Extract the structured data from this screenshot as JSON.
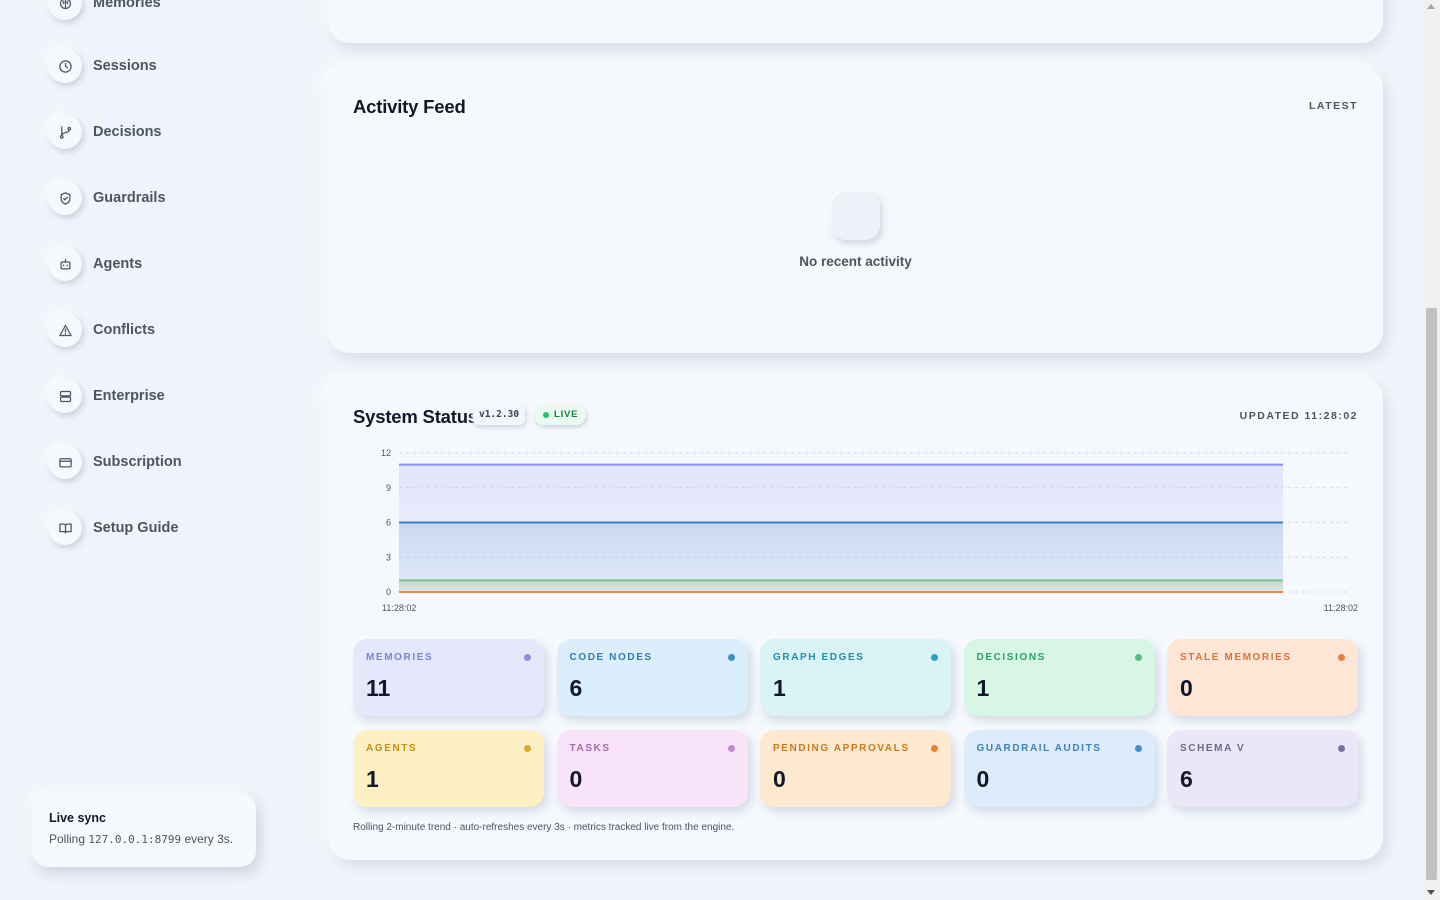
{
  "sidebar": {
    "items": [
      {
        "label": "Memories",
        "icon": "brain-icon"
      },
      {
        "label": "Sessions",
        "icon": "clock-icon"
      },
      {
        "label": "Decisions",
        "icon": "git-branch-icon"
      },
      {
        "label": "Guardrails",
        "icon": "shield-check-icon"
      },
      {
        "label": "Agents",
        "icon": "bot-icon"
      },
      {
        "label": "Conflicts",
        "icon": "warning-icon"
      },
      {
        "label": "Enterprise",
        "icon": "server-icon"
      },
      {
        "label": "Subscription",
        "icon": "credit-card-icon"
      },
      {
        "label": "Setup Guide",
        "icon": "book-open-icon"
      }
    ],
    "live_sync": {
      "title": "Live sync",
      "prefix": "Polling",
      "host": "127.0.0.1:8799",
      "suffix": "every 3s."
    }
  },
  "activity_feed": {
    "title": "Activity Feed",
    "meta": "LATEST",
    "empty_text": "No recent activity"
  },
  "system_status": {
    "title": "System Status",
    "version": "v1.2.30",
    "live_label": "LIVE",
    "updated": "UPDATED 11:28:02",
    "footnote": "Rolling 2-minute trend · auto-refreshes every 3s · metrics tracked live from the engine."
  },
  "chart_data": {
    "type": "area",
    "title": "",
    "xlabel": "",
    "ylabel": "",
    "x": [
      "11:28:02",
      "11:28:02"
    ],
    "ylim": [
      0,
      12
    ],
    "yticks": [
      0,
      3,
      6,
      9,
      12
    ],
    "grid": true,
    "series": [
      {
        "values": [
          11,
          11
        ],
        "color": "#8b8ff0"
      },
      {
        "values": [
          6,
          6
        ],
        "color": "#3b82c4"
      },
      {
        "values": [
          1,
          1
        ],
        "color": "#c9a227"
      },
      {
        "values": [
          1,
          1
        ],
        "color": "#7bc9a0"
      },
      {
        "values": [
          0,
          0
        ],
        "color": "#e98652"
      }
    ]
  },
  "metrics": [
    {
      "label": "MEMORIES",
      "value": "11",
      "bg": "#e5e8fb",
      "color": "#7b82d9",
      "dot": "#8a8fe0"
    },
    {
      "label": "CODE NODES",
      "value": "6",
      "bg": "#dbeefb",
      "color": "#2d7fb5",
      "dot": "#3b90c8"
    },
    {
      "label": "GRAPH EDGES",
      "value": "1",
      "bg": "#d9f3f7",
      "color": "#1f8fa6",
      "dot": "#20a5be"
    },
    {
      "label": "DECISIONS",
      "value": "1",
      "bg": "#d7f6e5",
      "color": "#2f9e68",
      "dot": "#4fbf84"
    },
    {
      "label": "STALE MEMORIES",
      "value": "0",
      "bg": "#fde6d6",
      "color": "#d9733a",
      "dot": "#ec7c45"
    },
    {
      "label": "AGENTS",
      "value": "1",
      "bg": "#fdf0c4",
      "color": "#c58f12",
      "dot": "#e0a72e"
    },
    {
      "label": "TASKS",
      "value": "0",
      "bg": "#f8e3f9",
      "color": "#a86ab0",
      "dot": "#c58acb"
    },
    {
      "label": "PENDING APPROVALS",
      "value": "0",
      "bg": "#fde9cf",
      "color": "#c97a1d",
      "dot": "#e8822f"
    },
    {
      "label": "GUARDRAIL AUDITS",
      "value": "0",
      "bg": "#dcecfb",
      "color": "#3a82be",
      "dot": "#3f8fd2"
    },
    {
      "label": "SCHEMA V",
      "value": "6",
      "bg": "#ebe6f8",
      "color": "#6f6790",
      "dot": "#7c6fa3"
    }
  ]
}
